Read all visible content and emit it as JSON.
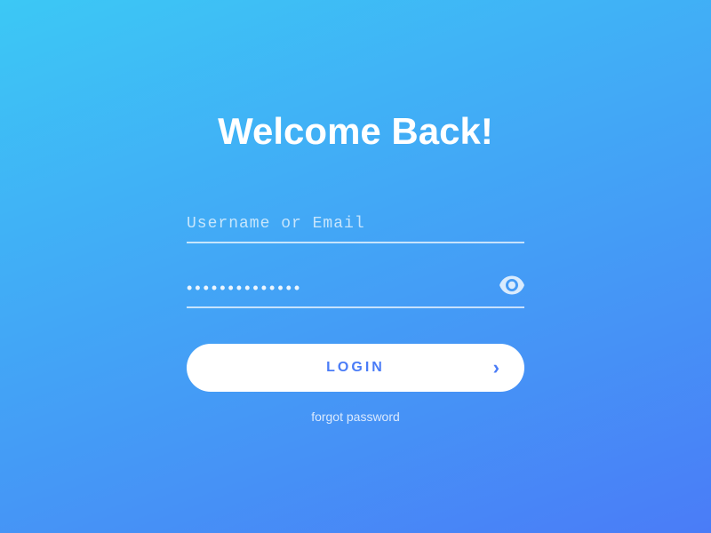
{
  "page": {
    "background_gradient_start": "#3cc8f5",
    "background_gradient_end": "#4a7cf7"
  },
  "header": {
    "title": "Welcome Back!"
  },
  "form": {
    "username_placeholder": "Username or Email",
    "password_placeholder": "••••••••••••••",
    "login_button_label": "LOGIN",
    "forgot_password_label": "forgot password"
  },
  "icons": {
    "eye": "eye-icon",
    "arrow": "›"
  }
}
